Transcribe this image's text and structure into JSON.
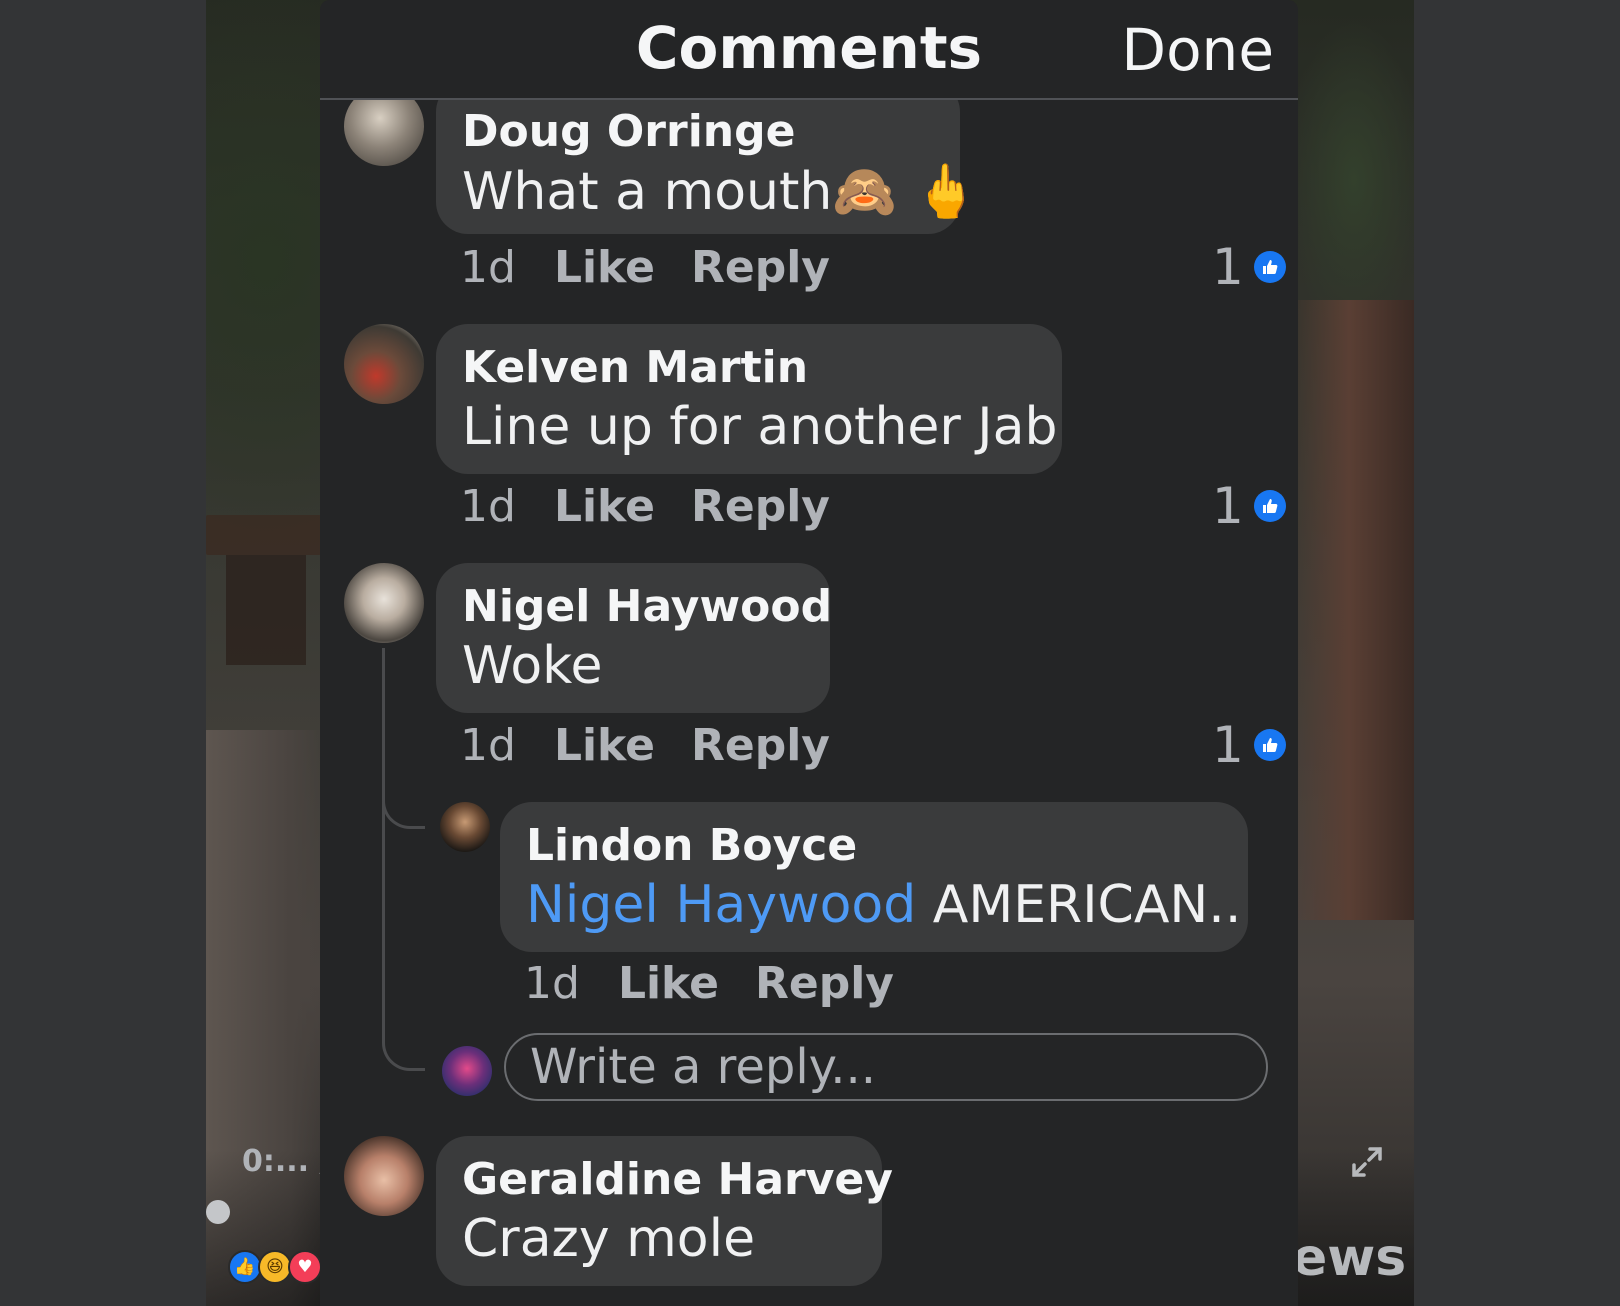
{
  "header": {
    "title": "Comments",
    "done_label": "Done"
  },
  "video": {
    "time_label": "0:... /",
    "views_text": "ews"
  },
  "comments": [
    {
      "author": "Doug Orringe",
      "text": "What a mouth",
      "emoji": "🙈 🖕",
      "time": "1d",
      "like_label": "Like",
      "reply_label": "Reply",
      "like_count": "1"
    },
    {
      "author": "Kelven Martin",
      "text": "Line up for another Jab",
      "time": "1d",
      "like_label": "Like",
      "reply_label": "Reply",
      "like_count": "1"
    },
    {
      "author": "Nigel Haywood",
      "text": "Woke",
      "time": "1d",
      "like_label": "Like",
      "reply_label": "Reply",
      "like_count": "1"
    },
    {
      "author": "Geraldine Harvey",
      "text": "Crazy mole"
    }
  ],
  "reply": {
    "author": "Lindon Boyce",
    "mention": "Nigel Haywood",
    "text": "AMERICAN..",
    "time": "1d",
    "like_label": "Like",
    "reply_label": "Reply"
  },
  "reply_input": {
    "placeholder": "Write a reply..."
  },
  "colors": {
    "panel_bg": "#242526",
    "bubble_bg": "#3a3b3c",
    "mention": "#4e9af5",
    "like_badge": "#1877f2"
  }
}
